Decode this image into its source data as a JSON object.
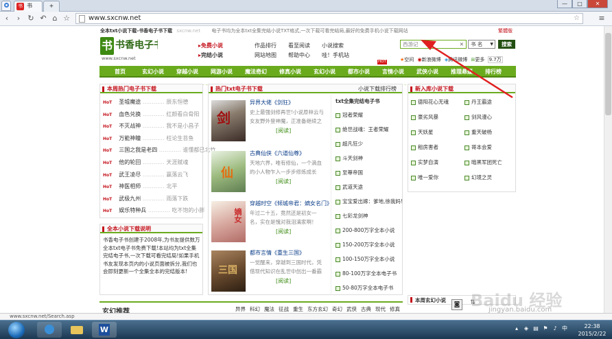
{
  "browser": {
    "tabs": [
      {
        "label": "书"
      }
    ],
    "url": "www.sxcnw.net",
    "status_url": "www.sxcnw.net/Search.asp"
  },
  "site": {
    "topline": "全本txt小说下载-书香电子书下载",
    "topline_domain": "sxcnw.net",
    "topline_notice": "电子书均为全本txt全集完结小说TXT格式,一次下载可看完结局,最好的免费手机小说下载网站",
    "simplified_link": "繁體版",
    "logo_text": "书香电子书",
    "logo_url": "www.sxcnw.net",
    "quick_links": {
      "free_novels": "免费小说",
      "complete_novels": "完结小说",
      "author_rank": "作品排行",
      "reading_tips": "看至阅读",
      "novel_search": "小说搜索",
      "site_map": "网站地图",
      "help": "帮助中心",
      "phone_site": "哇！手机站"
    },
    "search": {
      "placeholder": "西游记",
      "select_value": "书 名",
      "button": "搜索"
    },
    "bookmarks": {
      "add_space": "空间",
      "add_weibo": "新浪微博",
      "tencent": "腾讯微博",
      "more": "更多",
      "count": "9.7万"
    },
    "nav": [
      "首页",
      "玄幻小说",
      "穿越小说",
      "网游小说",
      "魔法奇幻",
      "修真小说",
      "玄幻小说",
      "都市小说",
      "言情小说",
      "武侠小说",
      "推理悬疑",
      "排行榜"
    ],
    "nav_badge": "HOT",
    "hot_box": {
      "title": "本周热门电子书下载",
      "hot_label": "HoT",
      "items": [
        {
          "name": "圣墟魔途",
          "author": "辰东恒德"
        },
        {
          "name": "血色兑换",
          "author": "红颜看白骨阳"
        },
        {
          "name": "不灭战神",
          "author": "我不是小昌子"
        },
        {
          "name": "万能神瞳",
          "author": "枉论生苔鱼"
        },
        {
          "name": "三国之我是老四",
          "author": "谁懂都已北竹"
        },
        {
          "name": "他的轮回",
          "author": "天涯赋魂"
        },
        {
          "name": "武王凌尽",
          "author": "赢落云飞"
        },
        {
          "name": "神医相师",
          "author": "北平"
        },
        {
          "name": "武极九州",
          "author": "雨落下跌"
        },
        {
          "name": "娱乐特种兵",
          "author": "吃不饱的小胖"
        }
      ]
    },
    "intro_box": {
      "title": "全本小说下载说明",
      "text": "书香电子书创建于2008年,为书友提供数万全本txt电子书免费下载!本站均为txt全集完结电子书,一次下载可看完结局!如果手机书友发现本页内的小说页面被拆分,我们也会即刻更新一个全集全本的完结版本!"
    },
    "center_box": {
      "title": "热门txt电子书下载",
      "more": "小说下载排行榜",
      "books": [
        {
          "title": "异界大佬《剑狂》",
          "desc": "史上最强剑修再世!小说原林云与女友野外登神魔，正准备继续之",
          "read": "[阅读]"
        },
        {
          "title": "古典仙侠《六道仙尊》",
          "desc": "天地六界，唯有修仙，一个滴血的小人物乍入一步步修炼成长",
          "read": "[阅读]"
        },
        {
          "title": "穿越时空《倾城帝君：嫡女名门》",
          "desc": "年过二十五，竟然还是初女一名，实在是愧对我泪漓家啊！",
          "read": "[阅读]"
        },
        {
          "title": "都市言情《重生三国》",
          "desc": "一觉醒来，穿越到三国时代，凭借现代知识在乱世中创出一番霸业",
          "read": "[阅读]"
        }
      ]
    },
    "mid_list": {
      "title": "txt全集完结电子书",
      "items": [
        "冠者荣耀",
        "绝世战魂：王者荣耀",
        "超凡狂少",
        "斗天剑神",
        "至尊帝国",
        "武道天途",
        "宝宝爱出嫁：爹地,徐我妈!",
        "七彩龙剑神",
        "200-800万字全本小说",
        "150-200万字全本小说",
        "100-150万字全本小说",
        "80-100万字全本电子书",
        "50-80万字全本电子书"
      ]
    },
    "new_box": {
      "title": "新入库小说下载",
      "items": [
        "德阳花心无魂",
        "丹王霸途",
        "豪劣风暴",
        "剑风漫心",
        "天妖星",
        "重天破杨",
        "租房害者",
        "哥本会爱",
        "实梦自演",
        "暗黑军团死亡",
        "唯一爱你",
        "幻境之灵"
      ]
    },
    "bottom_row": {
      "tags": [
        "异界",
        "科幻",
        "魔法",
        "征战",
        "重生",
        "东方玄幻",
        "奇幻",
        "武侠",
        "古典",
        "现代",
        "修真"
      ],
      "left_title": "玄幻推荐",
      "right_title": "本周玄幻小说"
    },
    "watermark": "Baidu 经验",
    "watermark_url": "jingyan.baidu.com"
  },
  "taskbar": {
    "time": "22:38",
    "date": "2015/2/22"
  }
}
